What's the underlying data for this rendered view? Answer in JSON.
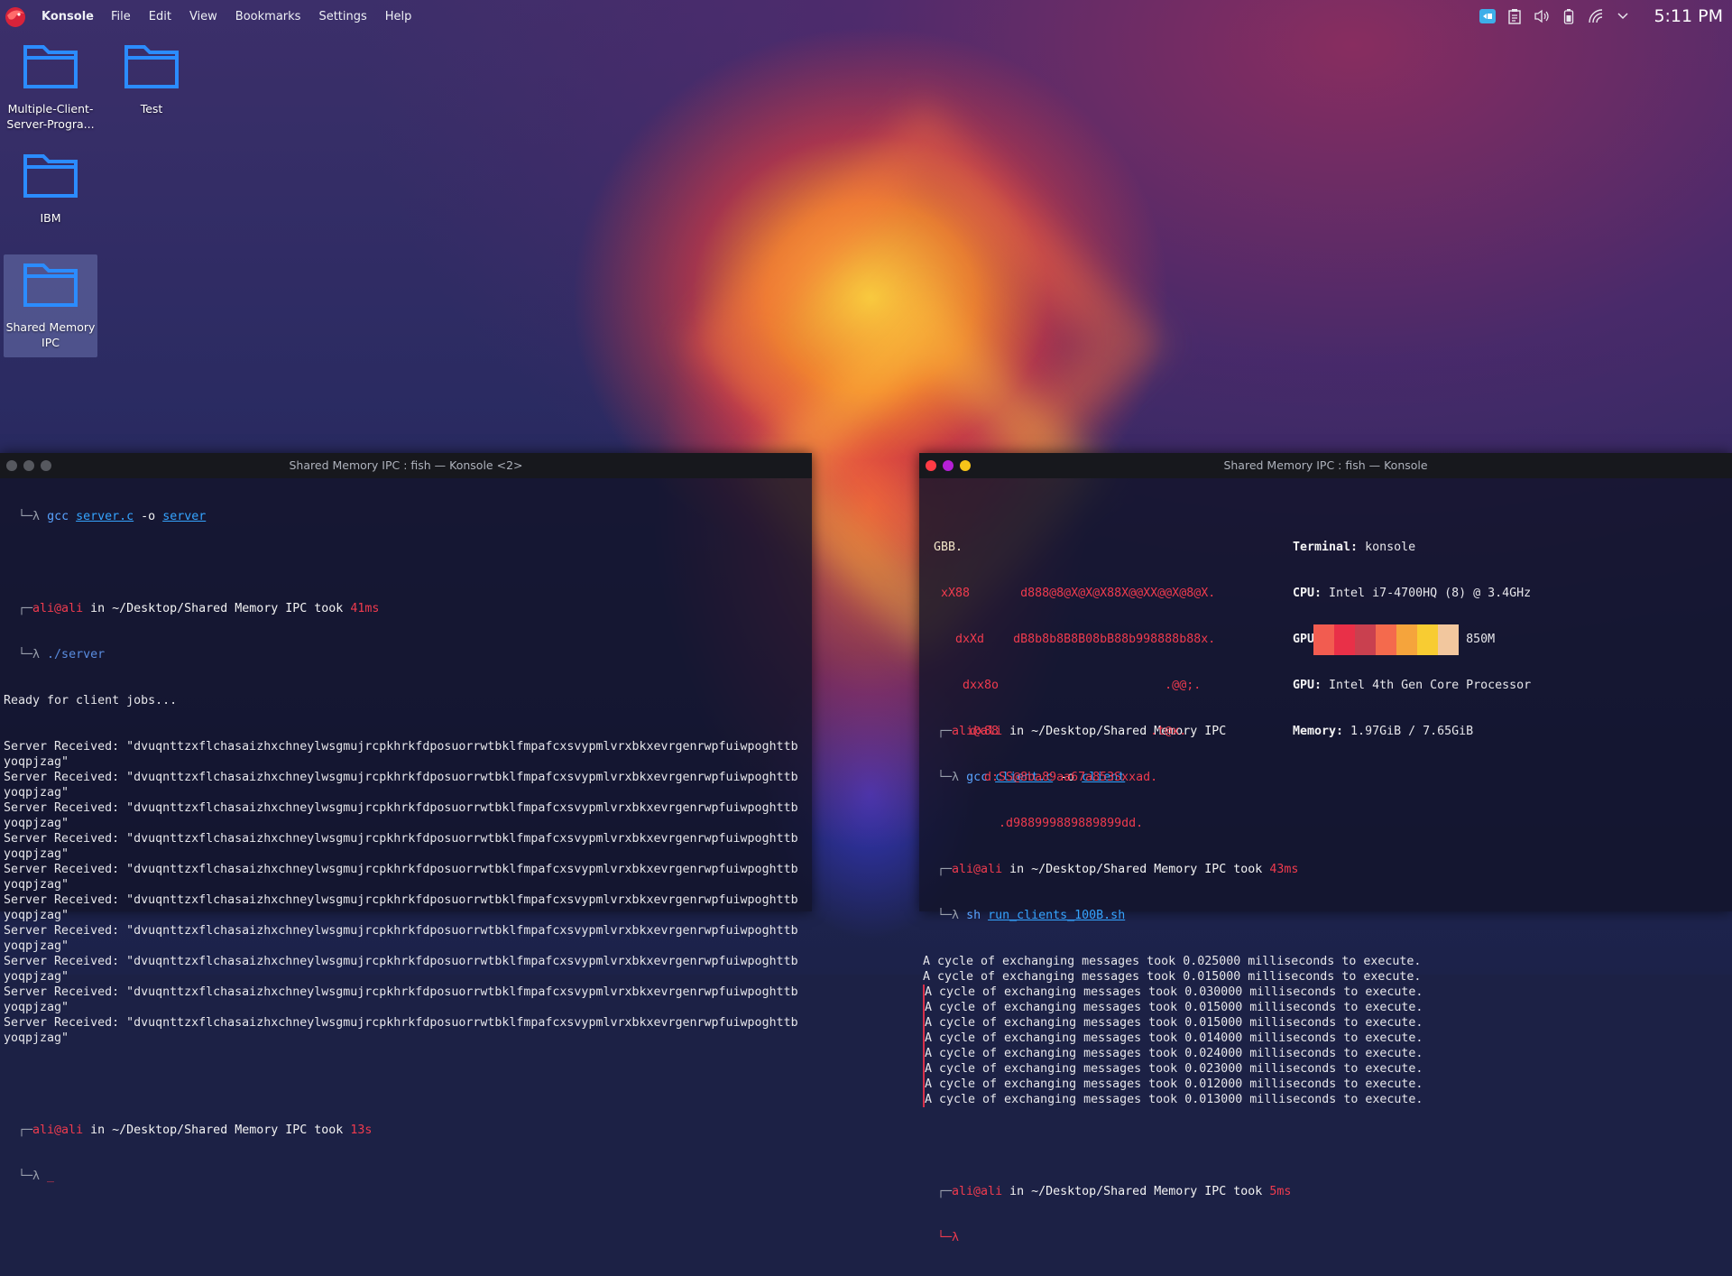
{
  "topbar": {
    "app_name": "Konsole",
    "menu": [
      "File",
      "Edit",
      "View",
      "Bookmarks",
      "Settings",
      "Help"
    ],
    "tray_icons": [
      "discover-icon",
      "clipboard-icon",
      "volume-icon",
      "battery-icon",
      "wifi-icon",
      "chevron-down-icon"
    ],
    "clock": "5:11 PM"
  },
  "desktop": {
    "icons": [
      {
        "label_l1": "Multiple-Client-",
        "label_l2": "Server-Progra...",
        "selected": false
      },
      {
        "label_l1": "Test",
        "label_l2": "",
        "selected": false
      },
      {
        "label_l1": "IBM",
        "label_l2": "",
        "selected": false
      },
      {
        "label_l1": "Shared Memory",
        "label_l2": "IPC",
        "selected": true
      }
    ]
  },
  "term_left": {
    "title": "Shared Memory IPC : fish — Konsole <2>",
    "prev_cmd": {
      "prompt": "└─λ",
      "cmd": "gcc",
      "arg1": "server.c",
      "flag": "-o",
      "arg2": "server"
    },
    "prompt1": {
      "user": "ali@ali",
      "in": " in ",
      "path": "~/Desktop/Shared Memory IPC",
      "took": " took ",
      "time": "41ms"
    },
    "run_cmd": "./server",
    "ready": "Ready for client jobs...",
    "recv_a": "Server Received: \"dvuqnttzxflchasaizhxchneylwsgmujrcpkhrkfdposuorrwtbklfmpafcxsvypmlvrxbkxevrgenrwpfuiwpoghttb",
    "recv_b": "yoqpjzag\"",
    "recv_count": 10,
    "prompt2": {
      "user": "ali@ali",
      "in": " in ",
      "path": "~/Desktop/Shared Memory IPC",
      "took": " took ",
      "time": "13s"
    },
    "cursor": "_"
  },
  "term_right": {
    "title": "Shared Memory IPC : fish — Konsole",
    "ascii": [
      " GBB.",
      "  xX88       d888@8@X@X@X88X@@XX@@X@8@X.",
      "    dxXd    dB8b8b8B8B08bB88b998888b88x.",
      "     dxx8o                       .@@;.",
      "      dx88                     .t@x.",
      "        d:SS@8ba89aa67a853Sxxad.",
      "          .d988999889889899dd."
    ],
    "info": [
      {
        "key": "Terminal:",
        "val": " konsole"
      },
      {
        "key": "CPU:",
        "val": " Intel i7-4700HQ (8) @ 3.4GHz"
      },
      {
        "key": "GPU:",
        "val": " NVIDIA GeForce GTX 850M"
      },
      {
        "key": "GPU:",
        "val": " Intel 4th Gen Core Processor"
      },
      {
        "key": "Memory:",
        "val": " 1.97GiB / 7.65GiB"
      }
    ],
    "swatches": [
      "#f25c50",
      "#e93048",
      "#c9404f",
      "#f46a4d",
      "#f5a43c",
      "#f8cc32",
      "#f2c79e"
    ],
    "prompt1": {
      "user": "ali@ali",
      "in": " in ",
      "path": "~/Desktop/Shared Memory IPC"
    },
    "cmd1": {
      "prompt": "└─λ",
      "cmd": "gcc",
      "arg1": "client.c",
      "flag": "-o",
      "arg2": "client"
    },
    "prompt2": {
      "user": "ali@ali",
      "in": " in ",
      "path": "~/Desktop/Shared Memory IPC",
      "took": " took ",
      "time": "43ms"
    },
    "cmd2": {
      "prompt": "└─λ",
      "cmd": "sh",
      "arg1": "run_clients_100B.sh"
    },
    "cycles": [
      "A cycle of exchanging messages took 0.025000 milliseconds to execute.",
      "A cycle of exchanging messages took 0.015000 milliseconds to execute.",
      "A cycle of exchanging messages took 0.030000 milliseconds to execute.",
      "A cycle of exchanging messages took 0.015000 milliseconds to execute.",
      "A cycle of exchanging messages took 0.015000 milliseconds to execute.",
      "A cycle of exchanging messages took 0.014000 milliseconds to execute.",
      "A cycle of exchanging messages took 0.024000 milliseconds to execute.",
      "A cycle of exchanging messages took 0.023000 milliseconds to execute.",
      "A cycle of exchanging messages took 0.012000 milliseconds to execute.",
      "A cycle of exchanging messages took 0.013000 milliseconds to execute."
    ],
    "prompt3": {
      "user": "ali@ali",
      "in": " in ",
      "path": "~/Desktop/Shared Memory IPC",
      "took": " took ",
      "time": "5ms"
    },
    "final_prompt": "└─λ"
  }
}
